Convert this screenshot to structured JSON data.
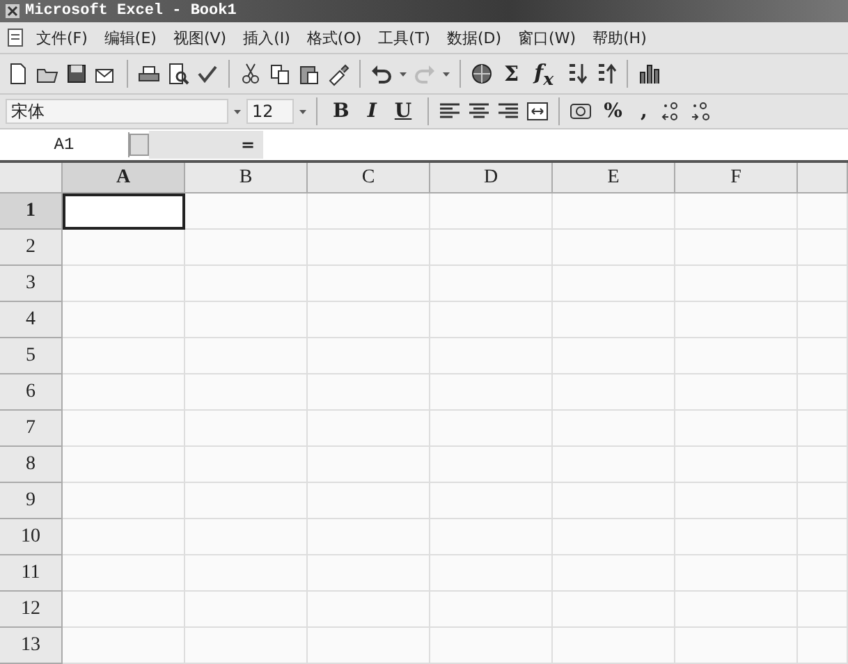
{
  "window": {
    "title": "Microsoft Excel - Book1"
  },
  "menu": [
    {
      "label": "文件(F)"
    },
    {
      "label": "编辑(E)"
    },
    {
      "label": "视图(V)"
    },
    {
      "label": "插入(I)"
    },
    {
      "label": "格式(O)"
    },
    {
      "label": "工具(T)"
    },
    {
      "label": "数据(D)"
    },
    {
      "label": "窗口(W)"
    },
    {
      "label": "帮助(H)"
    }
  ],
  "standard_toolbar": {
    "autosum": "Σ",
    "function": "f$_{x}$"
  },
  "formatting_toolbar": {
    "font": "宋体",
    "size": "12",
    "bold": "B",
    "italic": "I",
    "underline": "U",
    "percent": "%",
    "comma": ","
  },
  "formula_bar": {
    "name_box": "A1",
    "equals": "="
  },
  "sheet": {
    "columns": [
      {
        "label": "A",
        "selected": true
      },
      {
        "label": "B",
        "selected": false
      },
      {
        "label": "C",
        "selected": false
      },
      {
        "label": "D",
        "selected": false
      },
      {
        "label": "E",
        "selected": false
      },
      {
        "label": "F",
        "selected": false
      }
    ],
    "rows": [
      {
        "label": "1",
        "selected": true
      },
      {
        "label": "2",
        "selected": false
      },
      {
        "label": "3",
        "selected": false
      },
      {
        "label": "4",
        "selected": false
      },
      {
        "label": "5",
        "selected": false
      },
      {
        "label": "6",
        "selected": false
      },
      {
        "label": "7",
        "selected": false
      },
      {
        "label": "8",
        "selected": false
      },
      {
        "label": "9",
        "selected": false
      },
      {
        "label": "10",
        "selected": false
      },
      {
        "label": "11",
        "selected": false
      },
      {
        "label": "12",
        "selected": false
      },
      {
        "label": "13",
        "selected": false
      }
    ]
  }
}
